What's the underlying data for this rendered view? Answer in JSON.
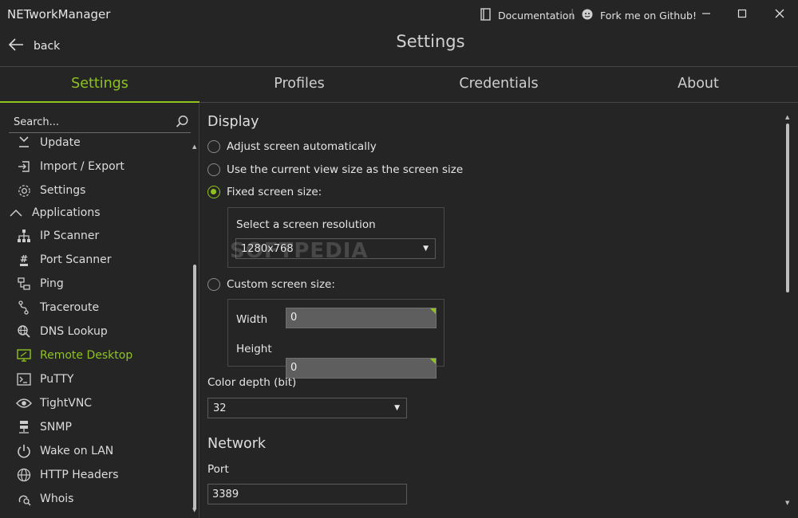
{
  "window": {
    "title": "NETworkManager"
  },
  "titlebar": {
    "documentation": "Documentation",
    "separator": "|",
    "github": "Fork me on Github!"
  },
  "header": {
    "back_label": "back",
    "page_title": "Settings"
  },
  "tabs": [
    {
      "label": "Settings",
      "active": true
    },
    {
      "label": "Profiles"
    },
    {
      "label": "Credentials"
    },
    {
      "label": "About"
    }
  ],
  "sidebar": {
    "search_placeholder": "Search...",
    "items": [
      {
        "label": "Update",
        "icon": "download-icon"
      },
      {
        "label": "Import / Export",
        "icon": "import-icon"
      },
      {
        "label": "Settings",
        "icon": "gear-icon"
      },
      {
        "label": "Applications",
        "icon": "chevron-up-icon"
      },
      {
        "label": "IP Scanner",
        "icon": "network-tree-icon"
      },
      {
        "label": "Port Scanner",
        "icon": "port-icon"
      },
      {
        "label": "Ping",
        "icon": "ping-icon"
      },
      {
        "label": "Traceroute",
        "icon": "traceroute-icon"
      },
      {
        "label": "DNS Lookup",
        "icon": "dns-search-icon"
      },
      {
        "label": "Remote Desktop",
        "icon": "remote-desktop-icon",
        "active": true
      },
      {
        "label": "PuTTY",
        "icon": "terminal-icon"
      },
      {
        "label": "TightVNC",
        "icon": "eye-icon"
      },
      {
        "label": "SNMP",
        "icon": "server-icon"
      },
      {
        "label": "Wake on LAN",
        "icon": "power-icon"
      },
      {
        "label": "HTTP Headers",
        "icon": "globe-icon"
      },
      {
        "label": "Whois",
        "icon": "whois-icon"
      }
    ]
  },
  "display": {
    "heading": "Display",
    "opt_auto": "Adjust screen automatically",
    "opt_view": "Use the current view size as the screen size",
    "opt_fixed": "Fixed screen size:",
    "resolution_label": "Select a screen resolution",
    "resolution_value": "1280x768",
    "opt_custom": "Custom screen size:",
    "width_label": "Width",
    "width_value": "0",
    "height_label": "Height",
    "height_value": "0",
    "color_depth_label": "Color depth (bit)",
    "color_depth_value": "32"
  },
  "network": {
    "heading": "Network",
    "port_label": "Port",
    "port_value": "3389"
  },
  "watermark": "SOFTPEDIA",
  "colors": {
    "accent": "#8fc31f",
    "background": "#252525"
  }
}
